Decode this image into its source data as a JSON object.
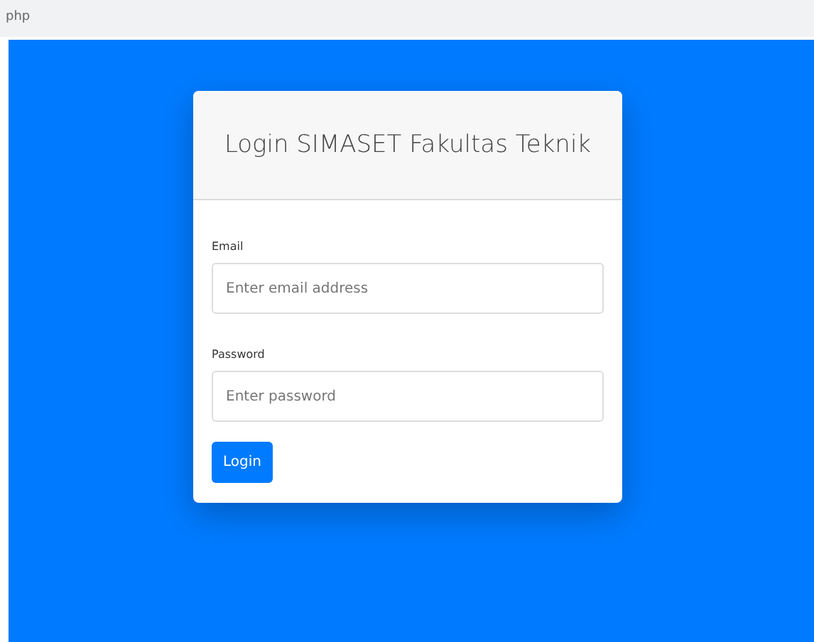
{
  "top_bar": {
    "text": "php"
  },
  "login_card": {
    "title": "Login SIMASET Fakultas Teknik",
    "fields": [
      {
        "label": "Email",
        "placeholder": "Enter email address"
      },
      {
        "label": "Password",
        "placeholder": "Enter password"
      }
    ],
    "button": "Login"
  }
}
